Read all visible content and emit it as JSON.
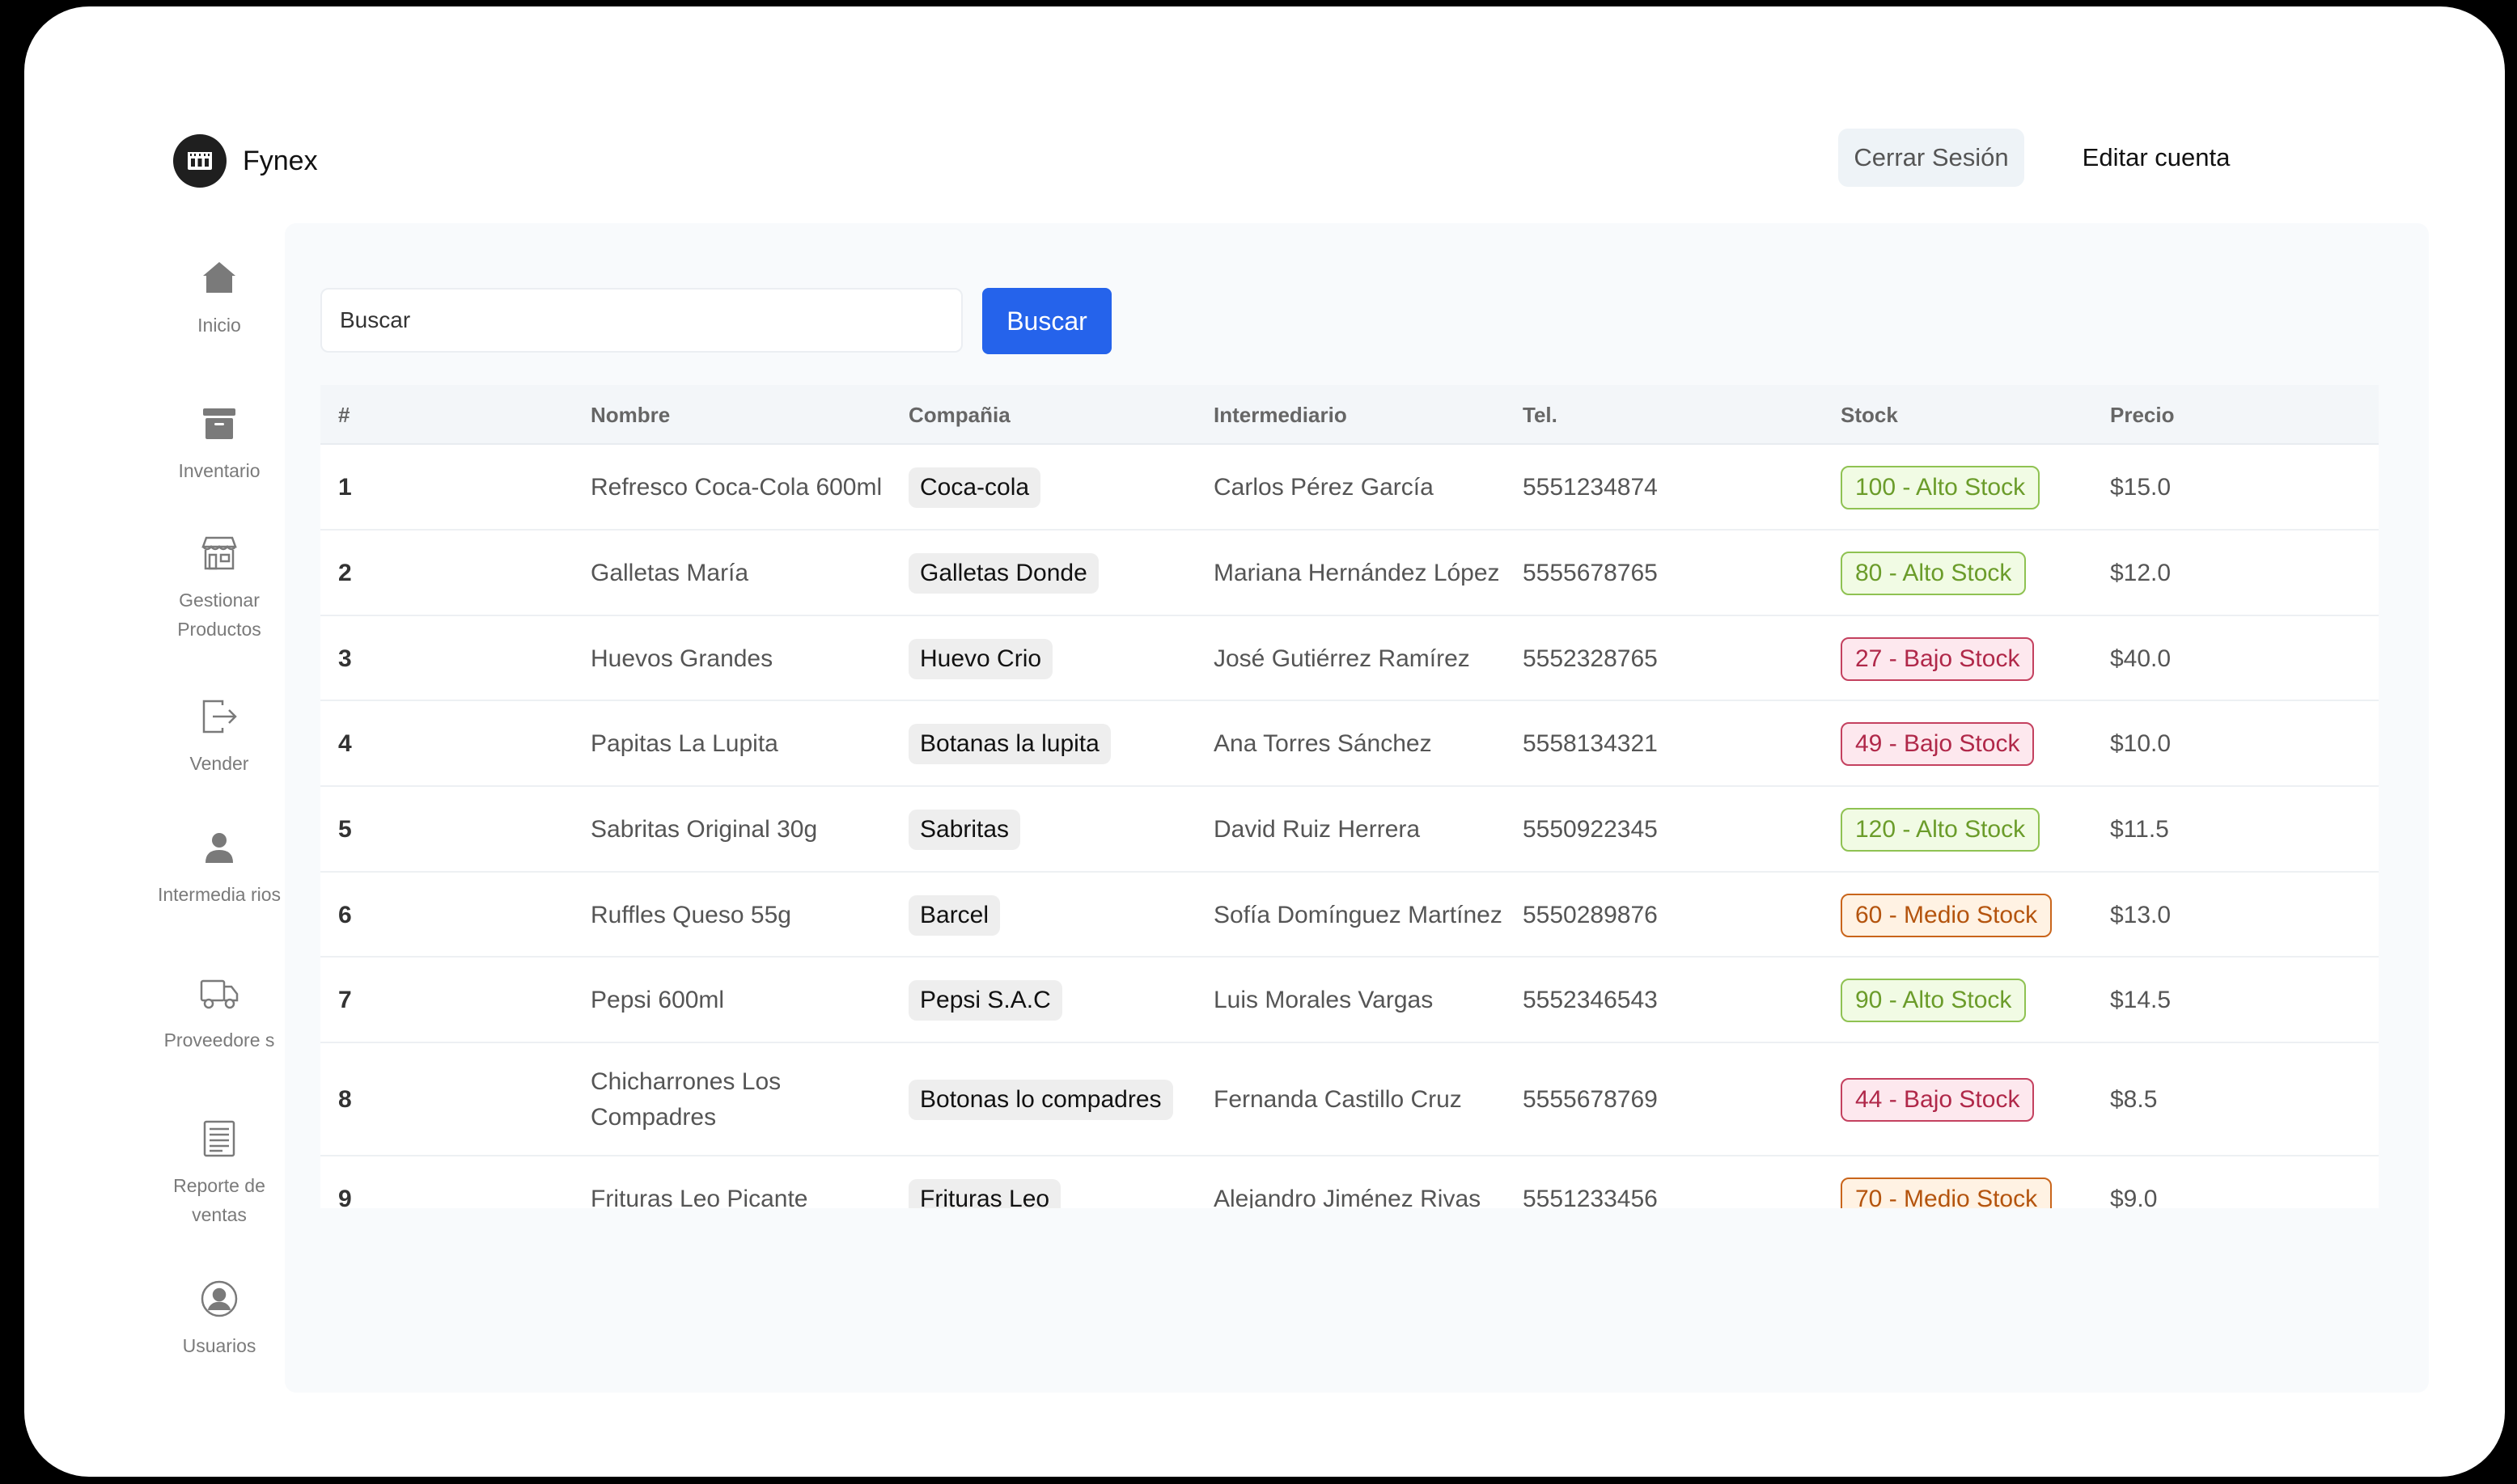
{
  "app": {
    "name": "Fynex"
  },
  "header": {
    "logout_label": "Cerrar Sesión",
    "edit_label": "Editar cuenta"
  },
  "sidebar": {
    "items": [
      {
        "label": "Inicio",
        "icon": "home-icon"
      },
      {
        "label": "Inventario",
        "icon": "archive-box-icon"
      },
      {
        "label": "Gestionar Productos",
        "icon": "store-icon"
      },
      {
        "label": "Vender",
        "icon": "exit-arrow-icon"
      },
      {
        "label": "Intermedia rios",
        "icon": "user-icon"
      },
      {
        "label": "Proveedore s",
        "icon": "truck-icon"
      },
      {
        "label": "Reporte de ventas",
        "icon": "receipt-icon"
      },
      {
        "label": "Usuarios",
        "icon": "user-circle-icon"
      }
    ]
  },
  "search": {
    "placeholder": "Buscar",
    "button_label": "Buscar"
  },
  "table": {
    "headers": [
      "#",
      "Nombre",
      "Compañia",
      "Intermediario",
      "Tel.",
      "Stock",
      "Precio"
    ],
    "rows": [
      {
        "num": "1",
        "nombre": "Refresco Coca-Cola 600ml",
        "compania": "Coca-cola",
        "intermediario": "Carlos Pérez García",
        "tel": "5551234874",
        "stock": "100 - Alto Stock",
        "level": "alto",
        "precio": "$15.0"
      },
      {
        "num": "2",
        "nombre": "Galletas María",
        "compania": "Galletas Donde",
        "intermediario": "Mariana Hernández López",
        "tel": "5555678765",
        "stock": "80 - Alto Stock",
        "level": "alto",
        "precio": "$12.0"
      },
      {
        "num": "3",
        "nombre": "Huevos Grandes",
        "compania": "Huevo Crio",
        "intermediario": "José Gutiérrez Ramírez",
        "tel": "5552328765",
        "stock": "27 - Bajo Stock",
        "level": "bajo",
        "precio": "$40.0"
      },
      {
        "num": "4",
        "nombre": "Papitas La Lupita",
        "compania": "Botanas la lupita",
        "intermediario": "Ana Torres Sánchez",
        "tel": "5558134321",
        "stock": "49 - Bajo Stock",
        "level": "bajo",
        "precio": "$10.0"
      },
      {
        "num": "5",
        "nombre": "Sabritas Original 30g",
        "compania": "Sabritas",
        "intermediario": "David Ruiz Herrera",
        "tel": "5550922345",
        "stock": "120 - Alto Stock",
        "level": "alto",
        "precio": "$11.5"
      },
      {
        "num": "6",
        "nombre": "Ruffles Queso 55g",
        "compania": "Barcel",
        "intermediario": "Sofía Domínguez Martínez",
        "tel": "5550289876",
        "stock": "60 - Medio Stock",
        "level": "medio",
        "precio": "$13.0"
      },
      {
        "num": "7",
        "nombre": "Pepsi 600ml",
        "compania": "Pepsi S.A.C",
        "intermediario": "Luis Morales Vargas",
        "tel": "5552346543",
        "stock": "90 - Alto Stock",
        "level": "alto",
        "precio": "$14.5"
      },
      {
        "num": "8",
        "nombre": "Chicharrones Los Compadres",
        "compania": "Botonas lo compadres",
        "intermediario": "Fernanda Castillo Cruz",
        "tel": "5555678769",
        "stock": "44 - Bajo Stock",
        "level": "bajo",
        "precio": "$8.5"
      },
      {
        "num": "9",
        "nombre": "Frituras Leo Picante",
        "compania": "Frituras Leo",
        "intermediario": "Alejandro Jiménez Rivas",
        "tel": "5551233456",
        "stock": "70 - Medio Stock",
        "level": "medio",
        "precio": "$9.0"
      }
    ]
  },
  "colors": {
    "accent": "#2563eb",
    "alto": "#6b9c2a",
    "bajo": "#b02849",
    "medio": "#b4540e"
  }
}
